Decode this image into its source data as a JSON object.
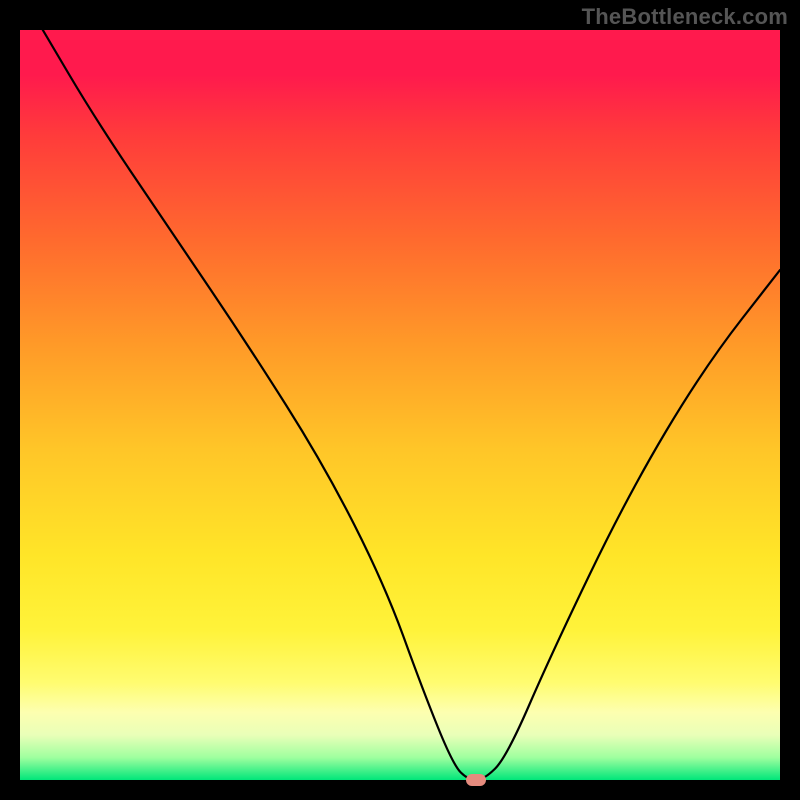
{
  "watermark": "TheBottleneck.com",
  "chart_data": {
    "type": "line",
    "title": "",
    "xlabel": "",
    "ylabel": "",
    "xlim": [
      0,
      100
    ],
    "ylim": [
      0,
      100
    ],
    "grid": false,
    "series": [
      {
        "name": "bottleneck-curve",
        "x": [
          3,
          10,
          20,
          30,
          40,
          48,
          53,
          57,
          59,
          61,
          64,
          70,
          80,
          90,
          100
        ],
        "y": [
          100,
          88,
          73,
          58,
          42,
          26,
          12,
          2,
          0,
          0,
          3,
          17,
          38,
          55,
          68
        ]
      }
    ],
    "annotations": [
      {
        "name": "optimal-marker",
        "x": 60,
        "y": 0
      }
    ],
    "gradient_stops": [
      {
        "pos": 0.0,
        "color": "#ff1a4d"
      },
      {
        "pos": 0.28,
        "color": "#ff6a2e"
      },
      {
        "pos": 0.56,
        "color": "#ffc628"
      },
      {
        "pos": 0.8,
        "color": "#fff33a"
      },
      {
        "pos": 0.94,
        "color": "#e9ffb8"
      },
      {
        "pos": 1.0,
        "color": "#00e67a"
      }
    ]
  }
}
